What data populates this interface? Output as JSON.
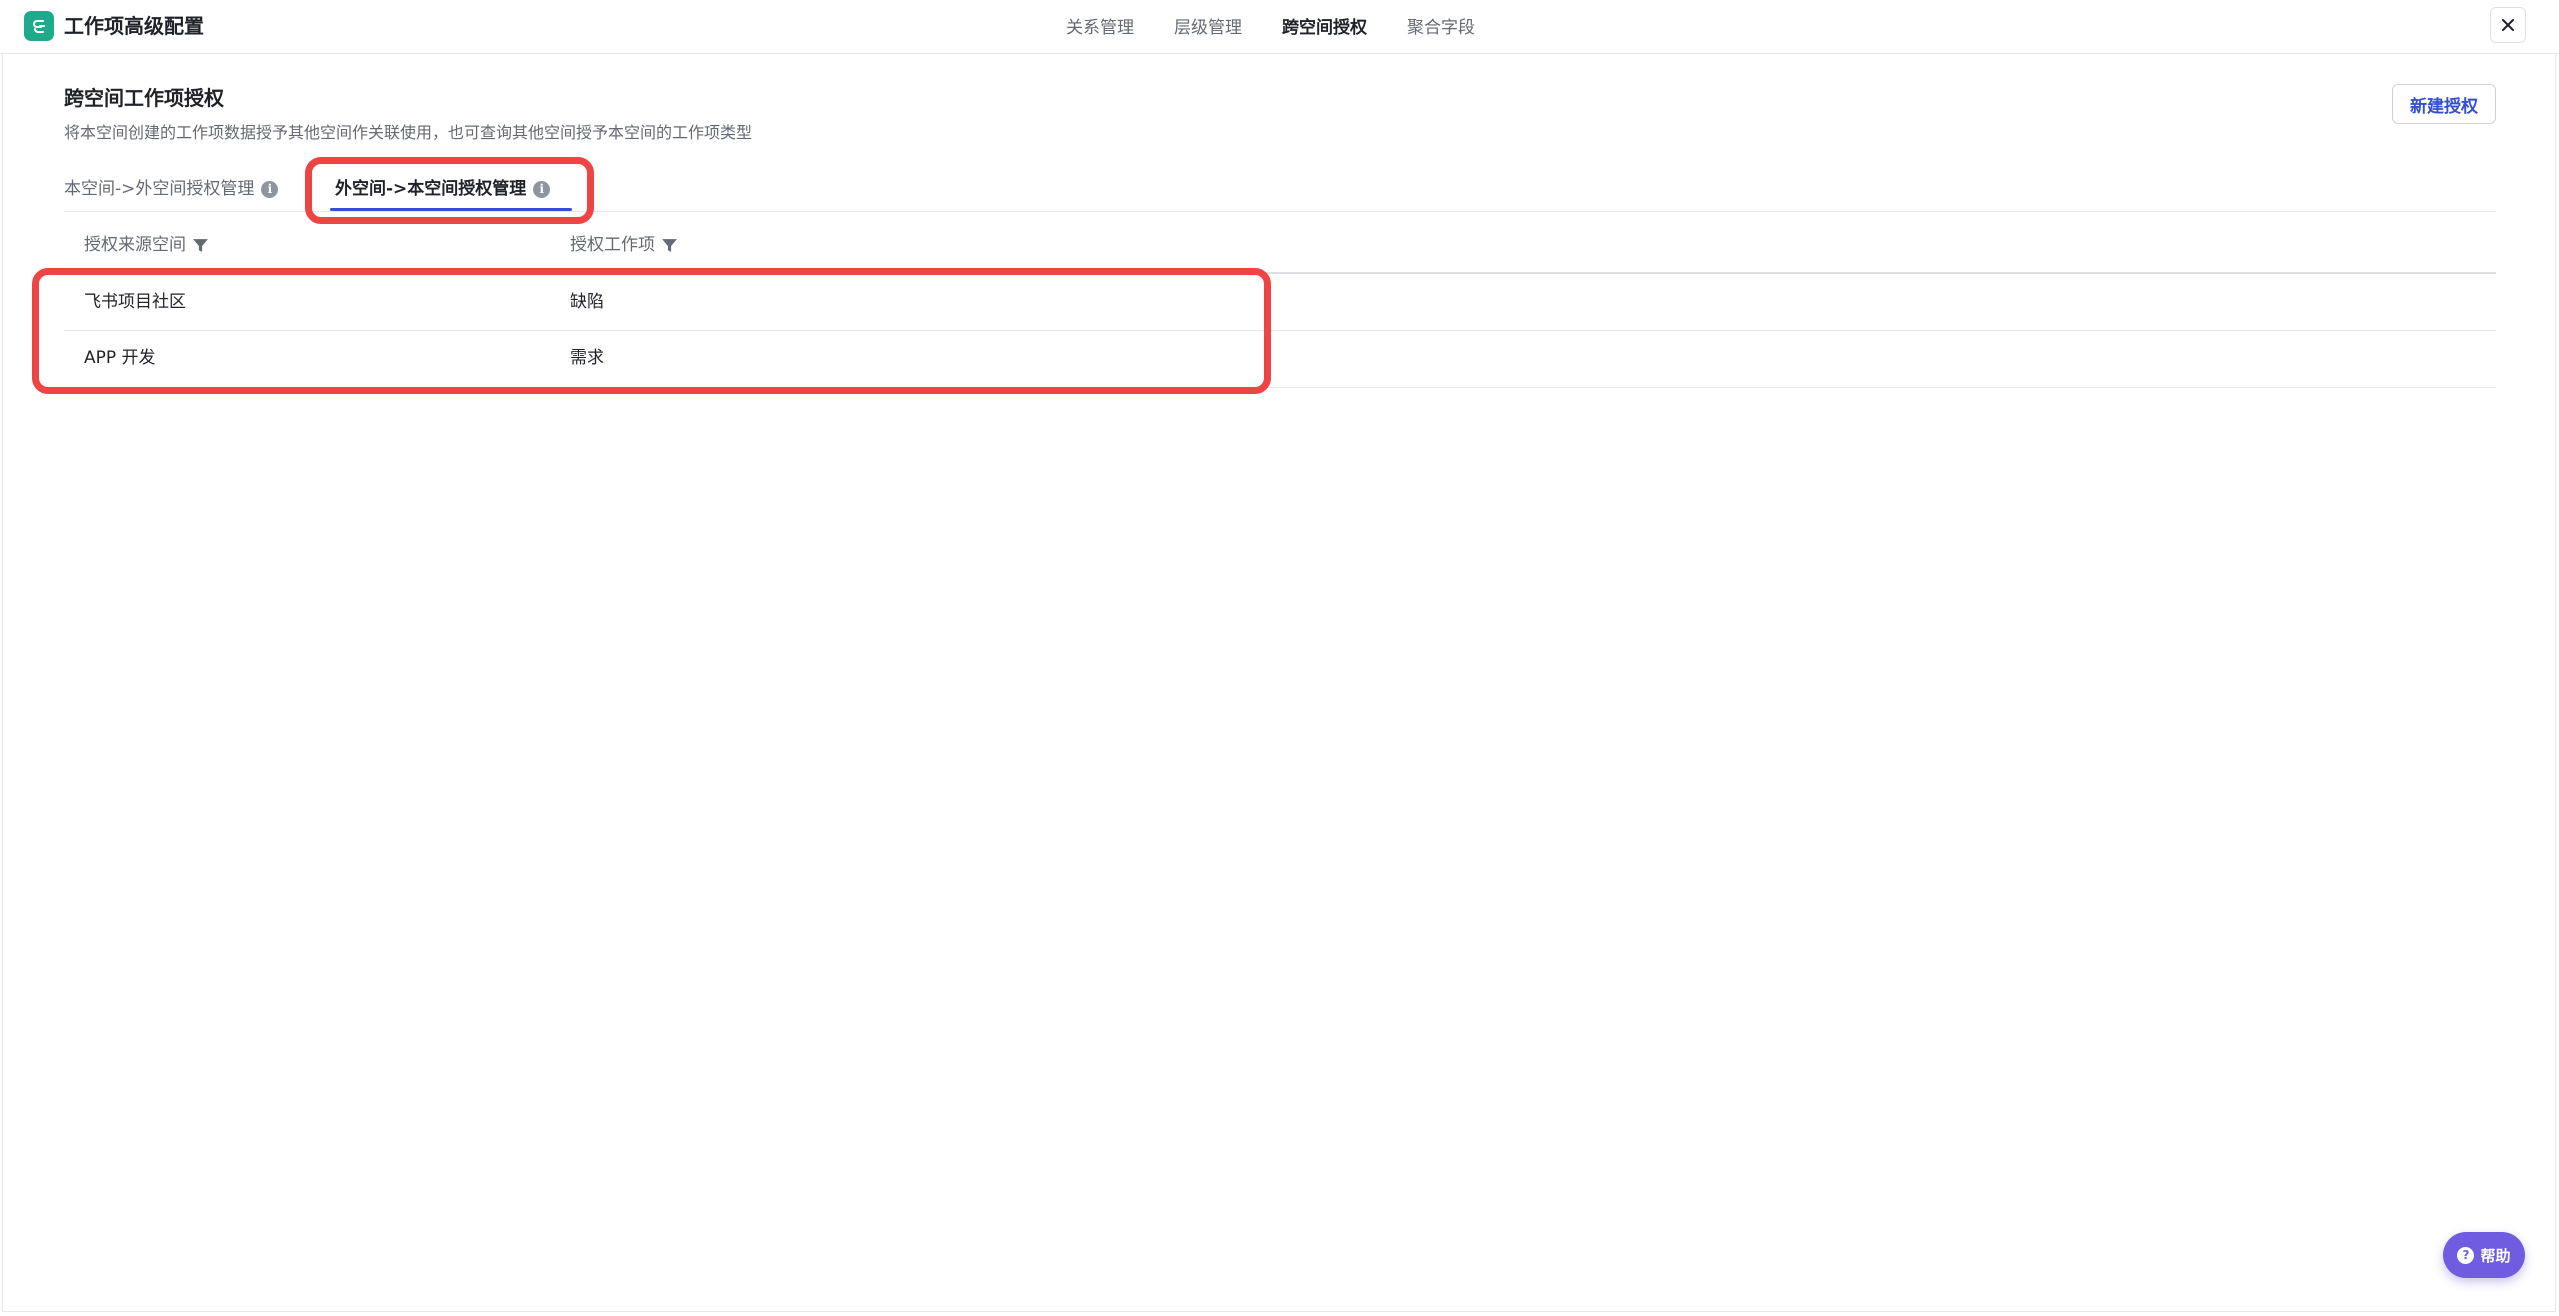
{
  "header": {
    "title": "工作项高级配置",
    "logo_icon": "app-logo-icon",
    "nav": [
      {
        "label": "关系管理",
        "active": false
      },
      {
        "label": "层级管理",
        "active": false
      },
      {
        "label": "跨空间授权",
        "active": true
      },
      {
        "label": "聚合字段",
        "active": false
      }
    ],
    "close_icon": "close-icon"
  },
  "section": {
    "title": "跨空间工作项授权",
    "description": "将本空间创建的工作项数据授予其他空间作关联使用，也可查询其他空间授予本空间的工作项类型",
    "new_button": "新建授权"
  },
  "sub_tabs": [
    {
      "label": "本空间->外空间授权管理",
      "active": false
    },
    {
      "label": "外空间->本空间授权管理",
      "active": true
    }
  ],
  "table": {
    "columns": [
      "授权来源空间",
      "授权工作项"
    ],
    "rows": [
      [
        "飞书项目社区",
        "缺陷"
      ],
      [
        "APP 开发",
        "需求"
      ]
    ]
  },
  "help": {
    "label": "帮助"
  },
  "colors": {
    "accent": "#3250d1",
    "highlight": "#ef4444",
    "logo": "#1faa8c",
    "help": "#6f5ce0"
  }
}
